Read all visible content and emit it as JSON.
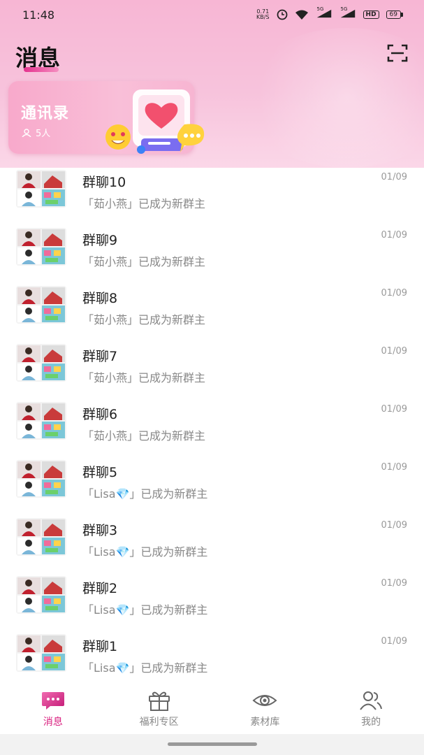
{
  "status_bar": {
    "time": "11:48",
    "net_speed_value": "0.71",
    "net_speed_unit": "KB/S",
    "signal1_label": "5G",
    "signal2_label": "5G",
    "hd_label": "HD",
    "battery": "69",
    "icons": [
      "alarm-icon",
      "wifi-icon",
      "signal-icon",
      "signal-icon",
      "hd-icon",
      "battery-icon"
    ]
  },
  "header": {
    "title": "消息",
    "accent_color": "#e4328e",
    "scan_icon": "scan-icon"
  },
  "contacts_card": {
    "title": "通讯录",
    "count": "5人"
  },
  "chats": [
    {
      "name": "群聊10",
      "preview": "「茹小燕」已成为新群主",
      "date": "01/09"
    },
    {
      "name": "群聊9",
      "preview": "「茹小燕」已成为新群主",
      "date": "01/09"
    },
    {
      "name": "群聊8",
      "preview": "「茹小燕」已成为新群主",
      "date": "01/09"
    },
    {
      "name": "群聊7",
      "preview": "「茹小燕」已成为新群主",
      "date": "01/09"
    },
    {
      "name": "群聊6",
      "preview": "「茹小燕」已成为新群主",
      "date": "01/09"
    },
    {
      "name": "群聊5",
      "preview": "「Lisa💎」已成为新群主",
      "date": "01/09"
    },
    {
      "name": "群聊3",
      "preview": "「Lisa💎」已成为新群主",
      "date": "01/09"
    },
    {
      "name": "群聊2",
      "preview": "「Lisa💎」已成为新群主",
      "date": "01/09"
    },
    {
      "name": "群聊1",
      "preview": "「Lisa💎」已成为新群主",
      "date": "01/09"
    }
  ],
  "tabs": [
    {
      "label": "消息",
      "icon": "message-icon",
      "active": true
    },
    {
      "label": "福利专区",
      "icon": "gift-icon",
      "active": false
    },
    {
      "label": "素材库",
      "icon": "eye-icon",
      "active": false
    },
    {
      "label": "我的",
      "icon": "profile-icon",
      "active": false
    }
  ]
}
